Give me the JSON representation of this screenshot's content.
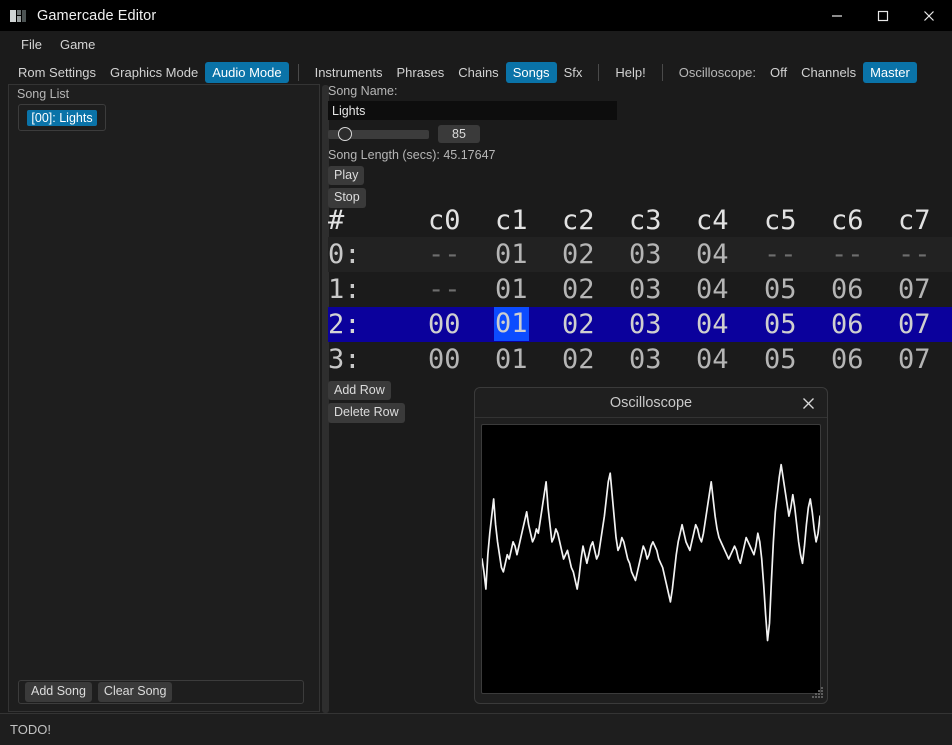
{
  "window": {
    "title": "Gamercade Editor",
    "icon": "app-icon",
    "controls": {
      "minimize": "minimize-icon",
      "maximize": "maximize-icon",
      "close": "close-icon"
    }
  },
  "menubar": {
    "items": [
      {
        "label": "File"
      },
      {
        "label": "Game"
      }
    ]
  },
  "toolbar": {
    "modes": [
      {
        "label": "Rom Settings",
        "selected": false
      },
      {
        "label": "Graphics Mode",
        "selected": false
      },
      {
        "label": "Audio Mode",
        "selected": true
      }
    ],
    "audio_tabs": [
      {
        "label": "Instruments",
        "selected": false
      },
      {
        "label": "Phrases",
        "selected": false
      },
      {
        "label": "Chains",
        "selected": false
      },
      {
        "label": "Songs",
        "selected": true
      },
      {
        "label": "Sfx",
        "selected": false
      }
    ],
    "help_label": "Help!",
    "oscilloscope_label": "Oscilloscope:",
    "oscilloscope_options": [
      {
        "label": "Off",
        "selected": false
      },
      {
        "label": "Channels",
        "selected": false
      },
      {
        "label": "Master",
        "selected": true
      }
    ]
  },
  "left_panel": {
    "title": "Song List",
    "songs": [
      {
        "label": "[00]: Lights",
        "selected": true
      }
    ],
    "footer_buttons": [
      {
        "label": "Add Song"
      },
      {
        "label": "Clear Song"
      }
    ]
  },
  "editor": {
    "song_name_label": "Song Name:",
    "song_name_value": "Lights",
    "bpm_value": "85",
    "bpm_slider_percent": 12,
    "song_length_label": "Song Length (secs): 45.17647",
    "play_label": "Play",
    "stop_label": "Stop",
    "add_row_label": "Add Row",
    "delete_row_label": "Delete Row"
  },
  "tracker": {
    "columns": [
      "#",
      "c0",
      "c1",
      "c2",
      "c3",
      "c4",
      "c5",
      "c6",
      "c7"
    ],
    "selected_row": 2,
    "selected_column": 2,
    "rows": [
      {
        "index": "0:",
        "cells": [
          "--",
          "01",
          "02",
          "03",
          "04",
          "--",
          "--",
          "--"
        ]
      },
      {
        "index": "1:",
        "cells": [
          "--",
          "01",
          "02",
          "03",
          "04",
          "05",
          "06",
          "07"
        ]
      },
      {
        "index": "2:",
        "cells": [
          "00",
          "01",
          "02",
          "03",
          "04",
          "05",
          "06",
          "07"
        ]
      },
      {
        "index": "3:",
        "cells": [
          "00",
          "01",
          "02",
          "03",
          "04",
          "05",
          "06",
          "07"
        ]
      }
    ]
  },
  "oscilloscope": {
    "title": "Oscilloscope",
    "close_icon": "close-icon",
    "waveform_color": "#f2f2f2",
    "background_color": "#000000",
    "waveform": [
      0.5,
      0.44,
      0.36,
      0.52,
      0.62,
      0.7,
      0.78,
      0.66,
      0.58,
      0.52,
      0.46,
      0.44,
      0.48,
      0.52,
      0.5,
      0.54,
      0.58,
      0.56,
      0.52,
      0.56,
      0.6,
      0.64,
      0.68,
      0.72,
      0.66,
      0.62,
      0.58,
      0.6,
      0.64,
      0.62,
      0.68,
      0.74,
      0.8,
      0.86,
      0.74,
      0.66,
      0.58,
      0.6,
      0.64,
      0.62,
      0.58,
      0.54,
      0.5,
      0.52,
      0.54,
      0.5,
      0.46,
      0.44,
      0.4,
      0.36,
      0.42,
      0.5,
      0.56,
      0.52,
      0.48,
      0.52,
      0.56,
      0.58,
      0.54,
      0.5,
      0.52,
      0.58,
      0.64,
      0.7,
      0.78,
      0.86,
      0.9,
      0.8,
      0.7,
      0.6,
      0.54,
      0.56,
      0.6,
      0.58,
      0.54,
      0.5,
      0.48,
      0.44,
      0.42,
      0.4,
      0.44,
      0.48,
      0.52,
      0.56,
      0.54,
      0.5,
      0.52,
      0.56,
      0.58,
      0.56,
      0.54,
      0.5,
      0.48,
      0.46,
      0.42,
      0.38,
      0.34,
      0.3,
      0.36,
      0.44,
      0.52,
      0.58,
      0.62,
      0.66,
      0.62,
      0.58,
      0.56,
      0.54,
      0.58,
      0.62,
      0.66,
      0.64,
      0.6,
      0.58,
      0.62,
      0.68,
      0.74,
      0.8,
      0.86,
      0.78,
      0.7,
      0.64,
      0.6,
      0.58,
      0.56,
      0.54,
      0.52,
      0.5,
      0.52,
      0.54,
      0.56,
      0.54,
      0.5,
      0.48,
      0.52,
      0.56,
      0.6,
      0.58,
      0.56,
      0.54,
      0.52,
      0.56,
      0.62,
      0.58,
      0.5,
      0.38,
      0.24,
      0.12,
      0.2,
      0.4,
      0.58,
      0.72,
      0.8,
      0.88,
      0.94,
      0.88,
      0.82,
      0.76,
      0.7,
      0.74,
      0.8,
      0.74,
      0.66,
      0.58,
      0.52,
      0.48,
      0.56,
      0.66,
      0.74,
      0.78,
      0.72,
      0.64,
      0.58,
      0.62,
      0.7
    ]
  },
  "statusbar": {
    "text": "TODO!"
  }
}
